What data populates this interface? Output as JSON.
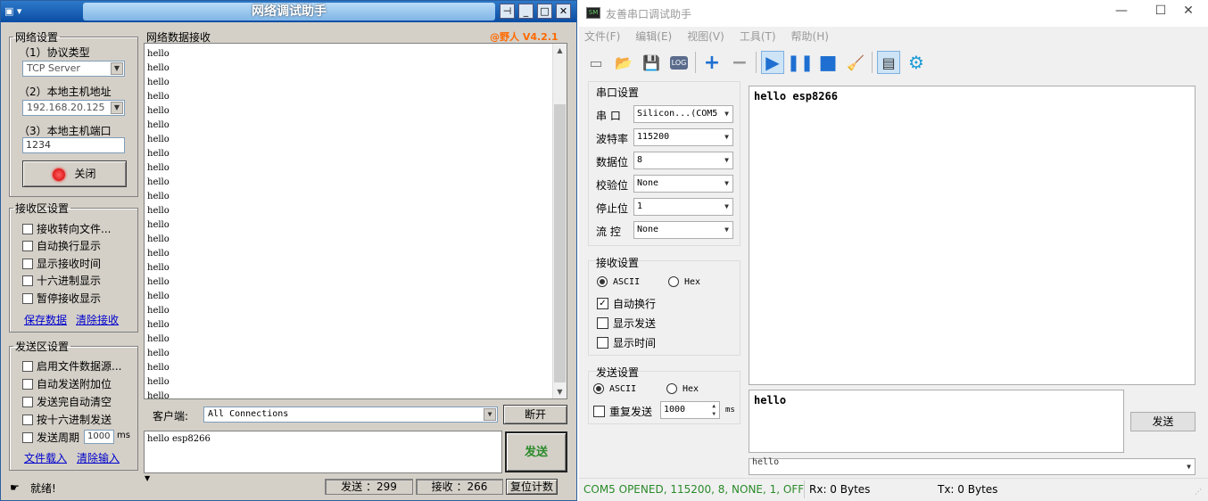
{
  "net": {
    "title": "网络调试助手",
    "version": "@野人 V4.2.1",
    "settings": {
      "group": "网络设置",
      "protocol_label": "（1）协议类型",
      "protocol_value": "TCP Server",
      "host_label": "（2）本地主机地址",
      "host_value": "192.168.20.125",
      "port_label": "（3）本地主机端口",
      "port_value": "1234",
      "close_label": "关闭"
    },
    "recv_settings": {
      "group": "接收区设置",
      "options": [
        "接收转向文件...",
        "自动换行显示",
        "显示接收时间",
        "十六进制显示",
        "暂停接收显示"
      ],
      "save_link": "保存数据",
      "clear_link": "清除接收"
    },
    "send_settings": {
      "group": "发送区设置",
      "options": [
        "启用文件数据源...",
        "自动发送附加位",
        "发送完自动清空",
        "按十六进制发送",
        "发送周期"
      ],
      "period_value": "1000",
      "period_unit": "ms",
      "load_link": "文件载入",
      "clear_link": "清除输入"
    },
    "recv_group": "网络数据接收",
    "recv_lines": [
      "hello",
      "hello",
      "hello",
      "hello",
      "hello",
      "hello",
      "hello",
      "hello",
      "hello",
      "hello",
      "hello",
      "hello",
      "hello",
      "hello",
      "hello",
      "hello",
      "hello",
      "hello",
      "hello",
      "hello",
      "hello",
      "hello",
      "hello",
      "hello",
      "hello"
    ],
    "client_label": "客户端:",
    "client_value": "All Connections",
    "disconnect_label": "断开",
    "send_text": "hello esp8266",
    "send_button": "发送",
    "status_text": "就绪!",
    "sent_count": "发送 ：299",
    "recv_count": "接收 ：266",
    "reset_label": "复位计数"
  },
  "serial": {
    "title": "友善串口调试助手",
    "menu": [
      "文件(F)",
      "编辑(E)",
      "视图(V)",
      "工具(T)",
      "帮助(H)"
    ],
    "port_settings": {
      "title": "串口设置",
      "rows": [
        {
          "label": "串  口",
          "value": "Silicon...(COM5"
        },
        {
          "label": "波特率",
          "value": "115200"
        },
        {
          "label": "数据位",
          "value": "8"
        },
        {
          "label": "校验位",
          "value": "None"
        },
        {
          "label": "停止位",
          "value": "1"
        },
        {
          "label": "流  控",
          "value": "None"
        }
      ]
    },
    "recv_settings": {
      "title": "接收设置",
      "ascii": "ASCII",
      "hex": "Hex",
      "auto_newline": "自动换行",
      "show_send": "显示发送",
      "show_time": "显示时间"
    },
    "send_settings": {
      "title": "发送设置",
      "ascii": "ASCII",
      "hex": "Hex",
      "repeat": "重复发送",
      "period": "1000",
      "unit": "ms"
    },
    "recv_text": "hello esp8266",
    "send_text": "hello",
    "send_button": "发送",
    "history_value": "hello",
    "status_port": "COM5 OPENED, 115200, 8, NONE, 1, OFF",
    "status_rx": "Rx: 0 Bytes",
    "status_tx": "Tx: 0 Bytes",
    "colors": {
      "status_green": "#2a8a2a",
      "play_blue": "#1e6fd1"
    }
  }
}
